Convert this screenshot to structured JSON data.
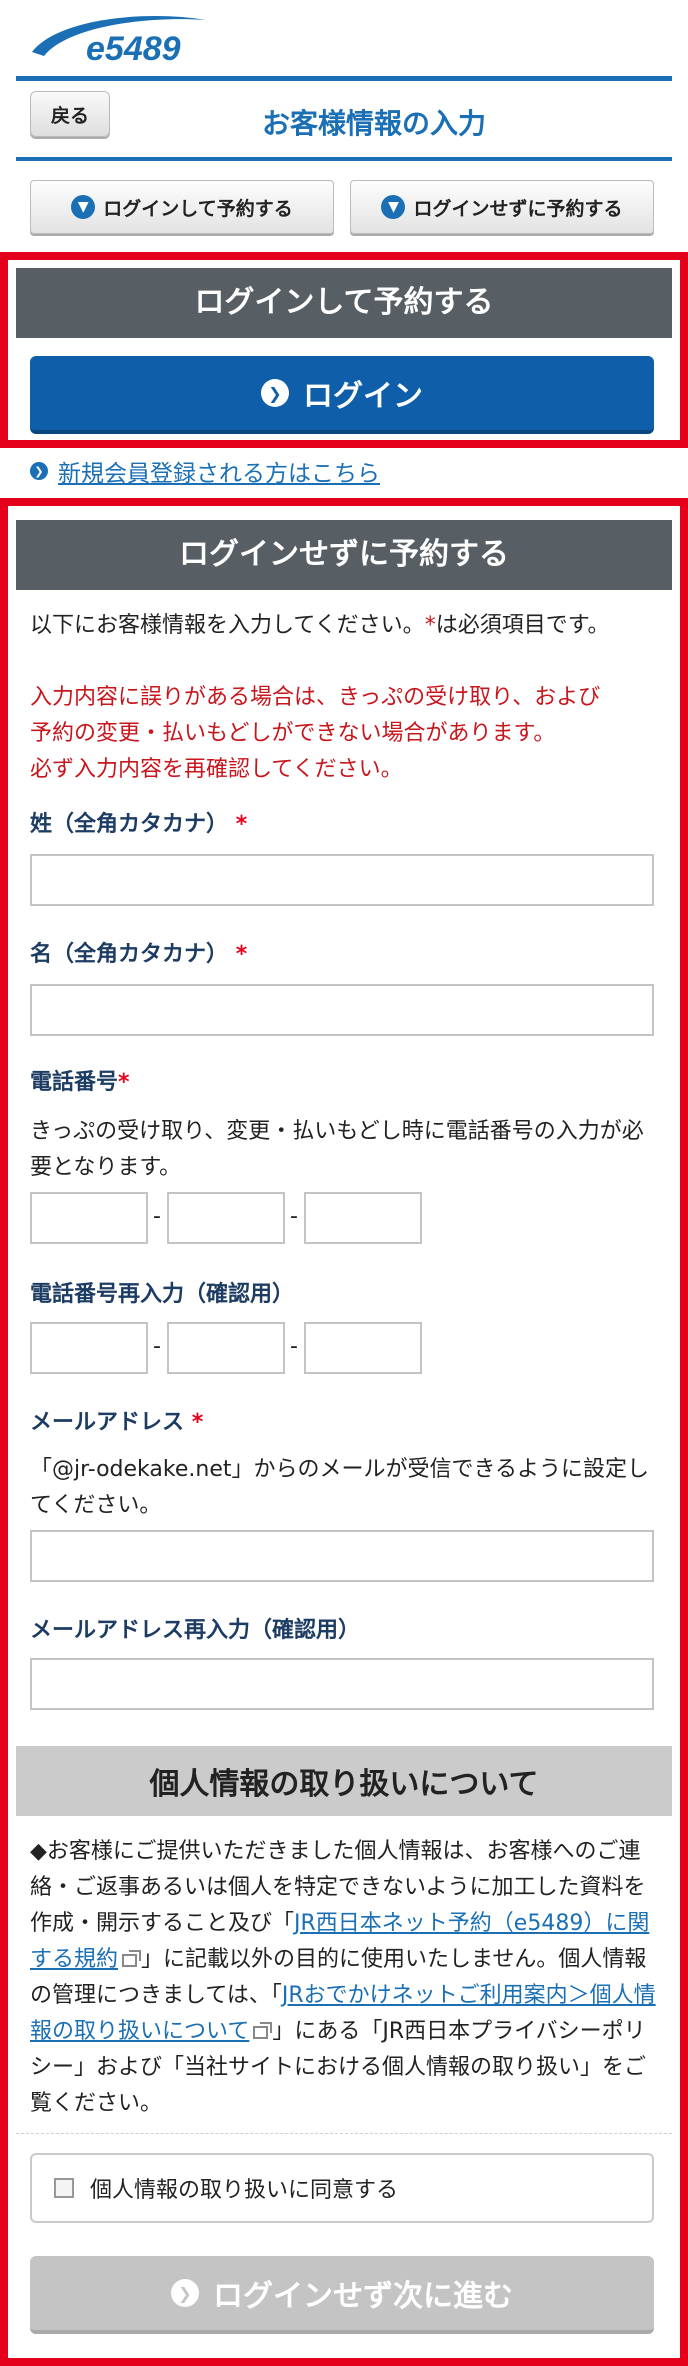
{
  "header": {
    "logo_text": "e5489",
    "back_label": "戻る",
    "title": "お客様情報の入力",
    "jump_login": "ログインして予約する",
    "jump_guest": "ログインせずに予約する"
  },
  "login_section": {
    "heading": "ログインして予約する",
    "login_button": "ログイン",
    "register_link": "新規会員登録される方はこちら"
  },
  "guest_section": {
    "heading": "ログインせずに予約する",
    "intro_1": "以下にお客様情報を入力してください。",
    "intro_star": "*",
    "intro_2": "は必須項目です。",
    "warning_1": "入力内容に誤りがある場合は、きっぷの受け取り、および",
    "warning_2": "予約の変更・払いもどしができない場合があります。",
    "warning_3": "必ず入力内容を再確認してください。",
    "required_star": "*",
    "last_name_label": "姓（全角カタカナ）",
    "first_name_label": "名（全角カタカナ）",
    "phone_label": "電話番号",
    "phone_note": "きっぷの受け取り、変更・払いもどし時に電話番号の入力が必要となります。",
    "phone_dash": "-",
    "phone_confirm_label": "電話番号再入力（確認用）",
    "email_label": "メールアドレス",
    "email_note": "「@jr-odekake.net」からのメールが受信できるように設定してください。",
    "email_confirm_label": "メールアドレス再入力（確認用）"
  },
  "privacy": {
    "heading": "個人情報の取り扱いについて",
    "text_1": "◆お客様にご提供いただきました個人情報は、お客様へのご連絡・ご返事あるいは個人を特定できないように加工した資料を作成・開示すること及び「",
    "link_1": "JR西日本ネット予約（e5489）に関する規約",
    "text_2": "」に記載以外の目的に使用いたしません。個人情報の管理につきましては、「",
    "link_2": "JRおでかけネットご利用案内＞個人情報の取り扱いについて",
    "text_3": "」にある「JR西日本プライバシーポリシー」および「当社サイトにおける個人情報の取り扱い」をご覧ください。",
    "agree_label": "個人情報の取り扱いに同意する",
    "next_button": "ログインせず次に進む"
  },
  "colors": {
    "brand_blue": "#1a6fb5",
    "frame_red": "#e4001b",
    "warning_red": "#c8161d",
    "heading_gray": "#575e64"
  }
}
